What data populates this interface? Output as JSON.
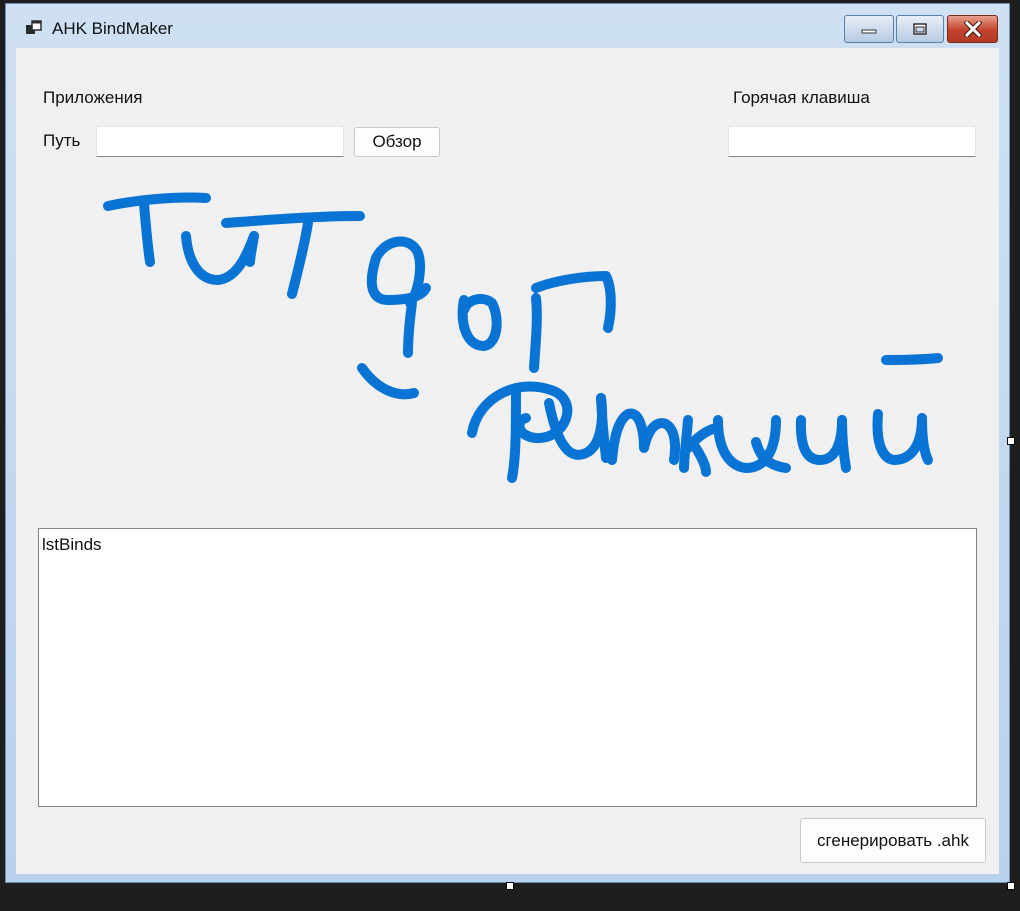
{
  "window": {
    "title": "AHK BindMaker"
  },
  "form": {
    "apps_label": "Приложения",
    "path_label": "Путь",
    "path_value": "",
    "browse_label": "Обзор",
    "hotkey_label": "Горячая клавиша",
    "hotkey_value": "",
    "list_name": "lstBinds",
    "generate_label": "сгенерировать .ahk"
  },
  "annotation": {
    "stroke_color": "#0a74d4"
  },
  "colors": {
    "client_bg": "#f0f0f0",
    "close_button": "#c4412c"
  }
}
